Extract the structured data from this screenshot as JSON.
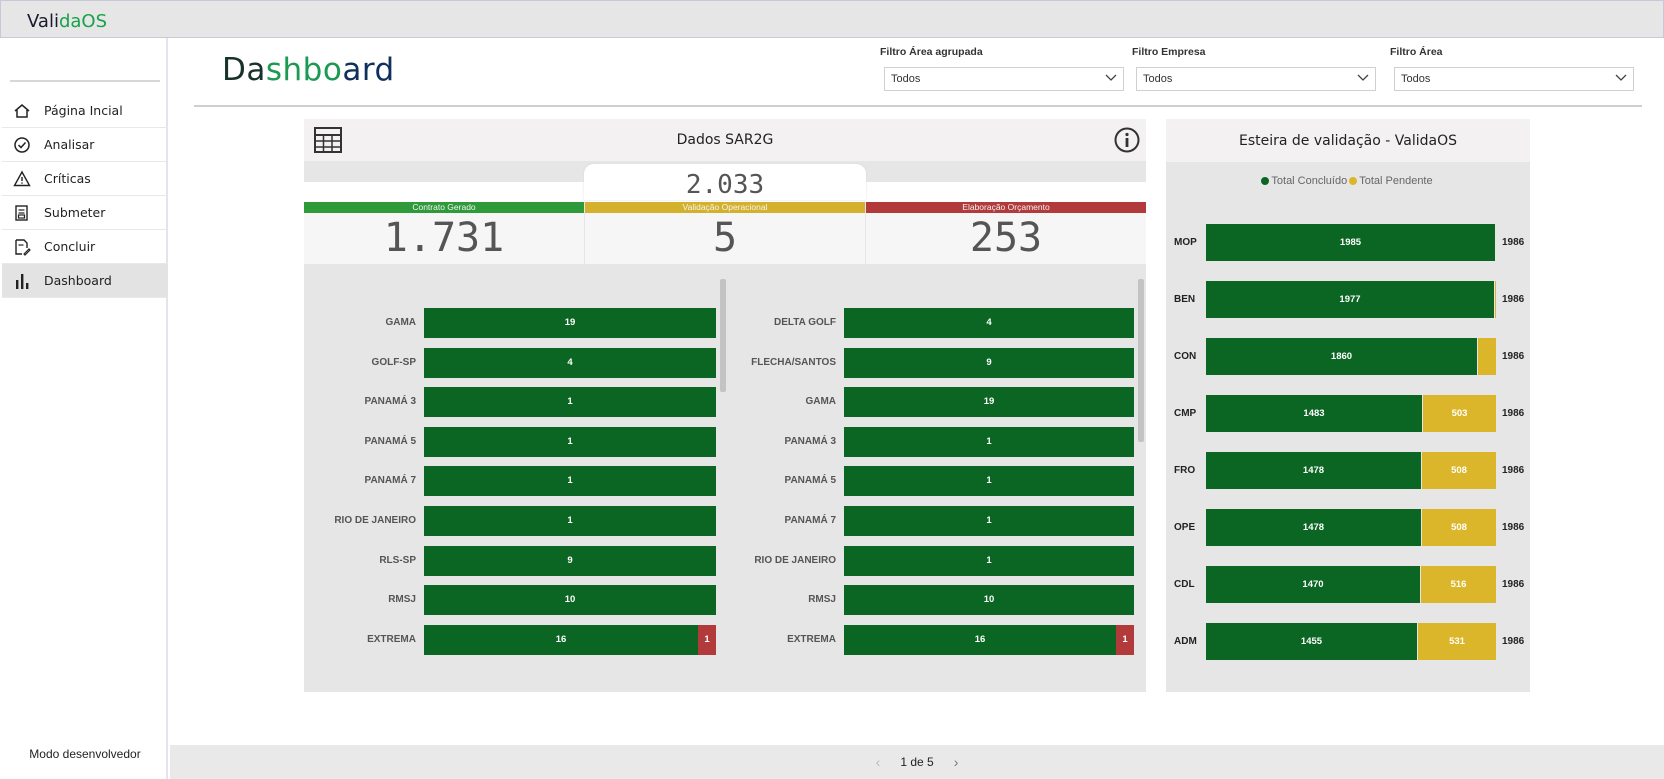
{
  "app": {
    "brand_dark": "Vali",
    "brand_accent": "daOS"
  },
  "sidebar": {
    "items": [
      {
        "label": "Página Incial",
        "icon": "home-icon"
      },
      {
        "label": "Analisar",
        "icon": "check-circle-icon"
      },
      {
        "label": "Críticas",
        "icon": "warning-icon"
      },
      {
        "label": "Submeter",
        "icon": "document-submit-icon"
      },
      {
        "label": "Concluir",
        "icon": "document-edit-icon"
      },
      {
        "label": "Dashboard",
        "icon": "bar-chart-icon",
        "active": true
      }
    ],
    "dev_mode": "Modo desenvolvedor"
  },
  "header": {
    "title_a": "Da",
    "title_b": "shbo",
    "title_c": "ard"
  },
  "filters": [
    {
      "label": "Filtro Área agrupada",
      "value": "Todos"
    },
    {
      "label": "Filtro Empresa",
      "value": "Todos"
    },
    {
      "label": "Filtro Área",
      "value": "Todos"
    }
  ],
  "sar2g": {
    "title": "Dados SAR2G",
    "total": "2.033",
    "kpis": [
      {
        "label": "Contrato Gerado",
        "value": "1.731",
        "color": "#2f9a3a"
      },
      {
        "label": "Validação Operacional",
        "value": "5",
        "color": "#d4b12c"
      },
      {
        "label": "Elaboração Orçamento",
        "value": "253",
        "color": "#b23a3a"
      }
    ],
    "left_list": [
      {
        "label": "GAMA",
        "green": 19,
        "red": null
      },
      {
        "label": "GOLF-SP",
        "green": 4,
        "red": null
      },
      {
        "label": "PANAMÁ 3",
        "green": 1,
        "red": null
      },
      {
        "label": "PANAMÁ 5",
        "green": 1,
        "red": null
      },
      {
        "label": "PANAMÁ 7",
        "green": 1,
        "red": null
      },
      {
        "label": "RIO DE JANEIRO",
        "green": 1,
        "red": null
      },
      {
        "label": "RLS-SP",
        "green": 9,
        "red": null
      },
      {
        "label": "RMSJ",
        "green": 10,
        "red": null
      },
      {
        "label": "EXTREMA",
        "green": 16,
        "red": 1
      }
    ],
    "right_list": [
      {
        "label": "DELTA GOLF",
        "green": 4,
        "red": null
      },
      {
        "label": "FLECHA/SANTOS",
        "green": 9,
        "red": null
      },
      {
        "label": "GAMA",
        "green": 19,
        "red": null
      },
      {
        "label": "PANAMÁ 3",
        "green": 1,
        "red": null
      },
      {
        "label": "PANAMÁ 5",
        "green": 1,
        "red": null
      },
      {
        "label": "PANAMÁ 7",
        "green": 1,
        "red": null
      },
      {
        "label": "RIO DE JANEIRO",
        "green": 1,
        "red": null
      },
      {
        "label": "RMSJ",
        "green": 10,
        "red": null
      },
      {
        "label": "EXTREMA",
        "green": 16,
        "red": 1
      }
    ]
  },
  "esteira": {
    "title": "Esteira de validação - ValidaOS",
    "legend": [
      {
        "label": "Total Concluído",
        "color": "#0b6623"
      },
      {
        "label": "Total Pendente",
        "color": "#dcb62a"
      }
    ]
  },
  "chart_data": {
    "type": "bar",
    "orientation": "horizontal",
    "stacked": true,
    "categories": [
      "MOP",
      "BEN",
      "CON",
      "CMP",
      "FRO",
      "OPE",
      "CDL",
      "ADM"
    ],
    "series": [
      {
        "name": "Total Concluído",
        "values": [
          1985,
          1977,
          1860,
          1483,
          1478,
          1478,
          1470,
          1455
        ]
      },
      {
        "name": "Total Pendente",
        "values": [
          1,
          9,
          126,
          503,
          508,
          508,
          516,
          531
        ]
      }
    ],
    "totals": [
      1986,
      1986,
      1986,
      1986,
      1986,
      1986,
      1986,
      1986
    ],
    "shown_pending_labels": [
      false,
      false,
      false,
      true,
      true,
      true,
      true,
      true
    ],
    "legend_position": "top"
  },
  "pagination": {
    "text": "1 de 5"
  }
}
